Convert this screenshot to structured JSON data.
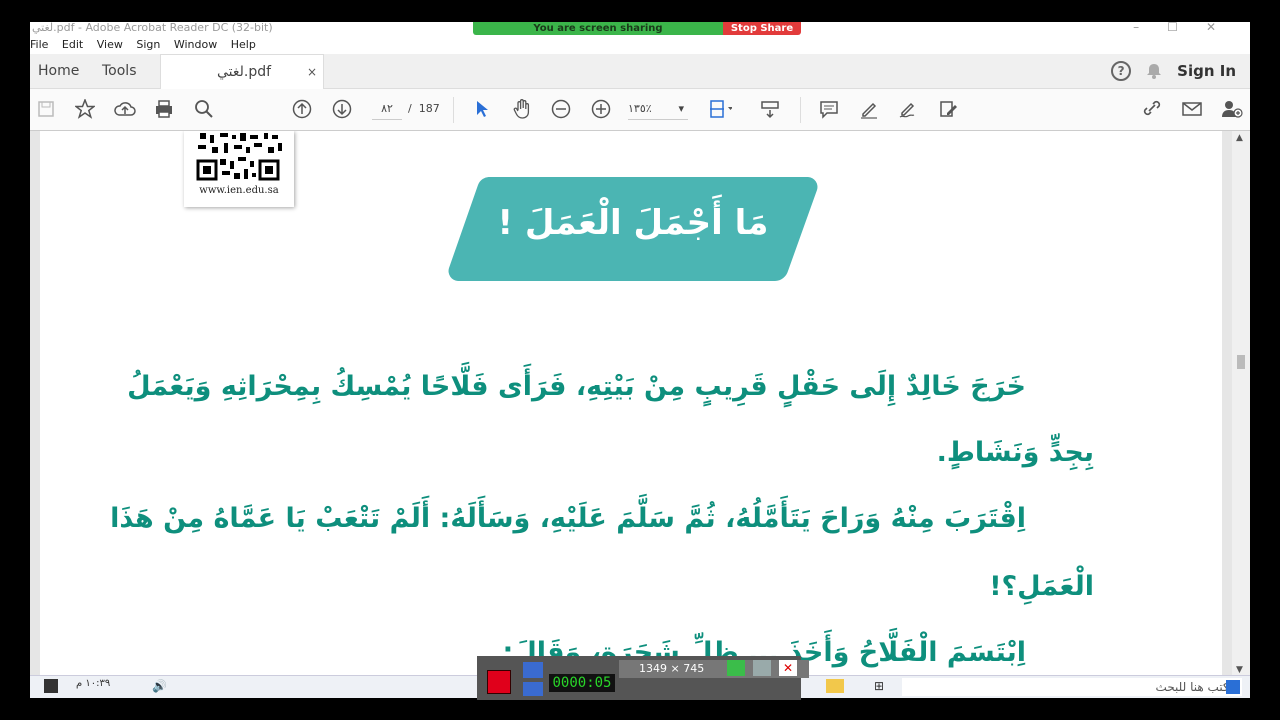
{
  "window": {
    "title": "لغتي.pdf - Adobe Acrobat Reader DC (32-bit)"
  },
  "share_bar": {
    "sharing_text": "You are screen sharing",
    "stop_label": "Stop Share"
  },
  "menu": [
    "File",
    "Edit",
    "View",
    "Sign",
    "Window",
    "Help"
  ],
  "tabs": {
    "home": "Home",
    "tools": "Tools",
    "document": "لغتي.pdf",
    "close": "×"
  },
  "account": {
    "help": "?",
    "sign_in": "Sign In"
  },
  "toolbar": {
    "page_current": "٨٢",
    "page_sep": "/",
    "page_total": "187",
    "zoom": "١٣٥٪"
  },
  "page": {
    "qr_url": "www.ien.edu.sa",
    "heading": "مَا أَجْمَلَ الْعَمَلَ !",
    "paragraphs": [
      "خَرَجَ خَالِدٌ إِلَى حَقْلٍ قَرِيبٍ مِنْ بَيْتِهِ، فَرَأَى فَلَّاحًا يُمْسِكُ بِمِحْرَاثِهِ وَيَعْمَلُ",
      "بِجِدٍّ وَنَشَاطٍ.",
      "اِقْتَرَبَ مِنْهُ وَرَاحَ يَتَأَمَّلُهُ، ثُمَّ سَلَّمَ عَلَيْهِ، وَسَأَلَهُ: أَلَمْ تَتْعَبْ يَا عَمَّاهُ مِنْ هَذَا",
      "الْعَمَلِ؟!",
      "اِبْتَسَمَ الْفَلَّاحُ وَأَخَذَ ... ظِلِّ شَجَرَةٍ، وَقَالَ:"
    ]
  },
  "recorder": {
    "timer": "0000:05",
    "dimensions": "1349 × 745"
  },
  "taskbar": {
    "search_placeholder": "اكتب هنا للبحث",
    "clock": "١٠:٣٩ م"
  },
  "colors": {
    "banner": "#4bb5b3",
    "text_teal": "#0e8f7d",
    "rec_stop": "#e0001b"
  }
}
